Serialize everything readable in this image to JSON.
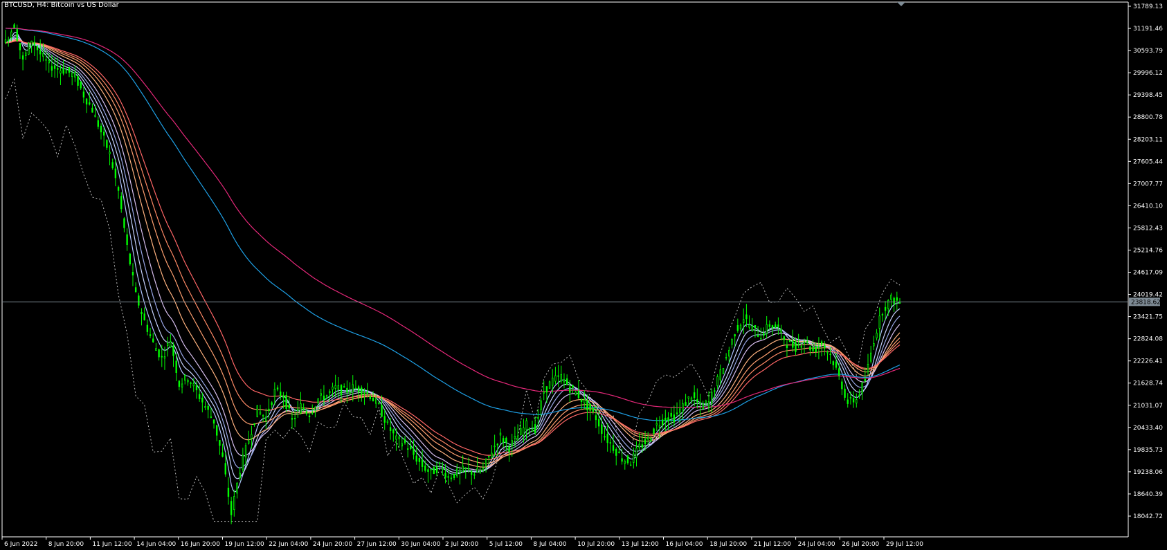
{
  "window": {
    "title": "BTCUSD, H4:  Bitcoin vs US Dollar"
  },
  "colors": {
    "background": "#000000",
    "grid": "#ffffff",
    "candle_bull": "#00ff00",
    "candle_bear": "#00ff00",
    "bid_line": "#7f8c96",
    "ma_fast": "#b0c4ff",
    "ma_slow_1": "#ff6666",
    "ma_slow_2": "#ffb380",
    "ma_long_cyan": "#1ea0e6",
    "ma_long_magenta": "#e6287a",
    "dotted_line": "#c0c0c0"
  },
  "price_axis": {
    "labels": [
      "31789.13",
      "31191.46",
      "30593.79",
      "29996.12",
      "29398.45",
      "28800.78",
      "28203.11",
      "27605.44",
      "27007.77",
      "26410.10",
      "25812.43",
      "25214.76",
      "24617.09",
      "24019.42",
      "23421.75",
      "22824.08",
      "22226.41",
      "21628.74",
      "21031.07",
      "20433.40",
      "19835.73",
      "19238.06",
      "18640.39",
      "18042.72"
    ],
    "bid_price": "23818.62"
  },
  "time_axis": {
    "labels": [
      "6 Jun 2022",
      "8 Jun 20:00",
      "11 Jun 12:00",
      "14 Jun 04:00",
      "16 Jun 20:00",
      "19 Jun 12:00",
      "22 Jun 04:00",
      "24 Jun 20:00",
      "27 Jun 12:00",
      "30 Jun 04:00",
      "2 Jul 20:00",
      "5 Jul 12:00",
      "8 Jul 04:00",
      "10 Jul 20:00",
      "13 Jul 12:00",
      "16 Jul 04:00",
      "18 Jul 20:00",
      "21 Jul 12:00",
      "24 Jul 04:00",
      "26 Jul 20:00",
      "29 Jul 12:00"
    ]
  },
  "chart_data": {
    "type": "candlestick",
    "symbol": "BTCUSD",
    "timeframe": "H4",
    "ylim": [
      17800,
      31900
    ],
    "price_ticks": [
      31789.13,
      31191.46,
      30593.79,
      29996.12,
      29398.45,
      28800.78,
      28203.11,
      27605.44,
      27007.77,
      26410.1,
      25812.43,
      25214.76,
      24617.09,
      24019.42,
      23421.75,
      22824.08,
      22226.41,
      21628.74,
      21031.07,
      20433.4,
      19835.73,
      19238.06,
      18640.39,
      18042.72
    ],
    "bid": 23818.62,
    "close_path": [
      [
        0,
        30800
      ],
      [
        1,
        31300
      ],
      [
        2,
        30300
      ],
      [
        3,
        30900
      ],
      [
        4,
        30500
      ],
      [
        5,
        30200
      ],
      [
        6,
        30100
      ],
      [
        7,
        30050
      ],
      [
        8,
        29900
      ],
      [
        9,
        29400
      ],
      [
        10,
        29000
      ],
      [
        11,
        28400
      ],
      [
        12,
        27800
      ],
      [
        13,
        26800
      ],
      [
        14,
        25300
      ],
      [
        15,
        24000
      ],
      [
        16,
        23300
      ],
      [
        17,
        22700
      ],
      [
        18,
        22300
      ],
      [
        19,
        22800
      ],
      [
        20,
        21600
      ],
      [
        21,
        21800
      ],
      [
        22,
        21400
      ],
      [
        23,
        21000
      ],
      [
        24,
        20600
      ],
      [
        25,
        19600
      ],
      [
        26,
        18100
      ],
      [
        27,
        19300
      ],
      [
        28,
        20100
      ],
      [
        29,
        20900
      ],
      [
        30,
        20700
      ],
      [
        31,
        21400
      ],
      [
        32,
        21300
      ],
      [
        33,
        20600
      ],
      [
        34,
        21000
      ],
      [
        35,
        20800
      ],
      [
        36,
        21200
      ],
      [
        37,
        21300
      ],
      [
        38,
        21500
      ],
      [
        39,
        21400
      ],
      [
        40,
        21500
      ],
      [
        41,
        21450
      ],
      [
        42,
        21300
      ],
      [
        43,
        21000
      ],
      [
        44,
        20500
      ],
      [
        45,
        20100
      ],
      [
        46,
        20000
      ],
      [
        47,
        19700
      ],
      [
        48,
        19400
      ],
      [
        49,
        19200
      ],
      [
        50,
        19400
      ],
      [
        51,
        19100
      ],
      [
        52,
        19200
      ],
      [
        53,
        19300
      ],
      [
        54,
        19200
      ],
      [
        55,
        19300
      ],
      [
        56,
        19800
      ],
      [
        57,
        20200
      ],
      [
        58,
        19900
      ],
      [
        59,
        20200
      ],
      [
        60,
        20500
      ],
      [
        61,
        20400
      ],
      [
        62,
        21400
      ],
      [
        63,
        21700
      ],
      [
        64,
        21800
      ],
      [
        65,
        21500
      ],
      [
        66,
        21300
      ],
      [
        67,
        21000
      ],
      [
        68,
        20700
      ],
      [
        69,
        20200
      ],
      [
        70,
        19900
      ],
      [
        71,
        19600
      ],
      [
        72,
        19500
      ],
      [
        73,
        19900
      ],
      [
        74,
        20100
      ],
      [
        75,
        20500
      ],
      [
        76,
        20700
      ],
      [
        77,
        20700
      ],
      [
        78,
        21000
      ],
      [
        79,
        21300
      ],
      [
        80,
        21000
      ],
      [
        81,
        21100
      ],
      [
        82,
        21700
      ],
      [
        83,
        22300
      ],
      [
        84,
        23000
      ],
      [
        85,
        23400
      ],
      [
        86,
        23100
      ],
      [
        87,
        22900
      ],
      [
        88,
        23200
      ],
      [
        89,
        23100
      ],
      [
        90,
        22700
      ],
      [
        91,
        22600
      ],
      [
        92,
        22800
      ],
      [
        93,
        22500
      ],
      [
        94,
        22700
      ],
      [
        95,
        22400
      ],
      [
        96,
        21800
      ],
      [
        97,
        21100
      ],
      [
        98,
        21200
      ],
      [
        99,
        21700
      ],
      [
        100,
        22800
      ],
      [
        101,
        23600
      ],
      [
        102,
        23900
      ],
      [
        103,
        23800
      ]
    ]
  }
}
